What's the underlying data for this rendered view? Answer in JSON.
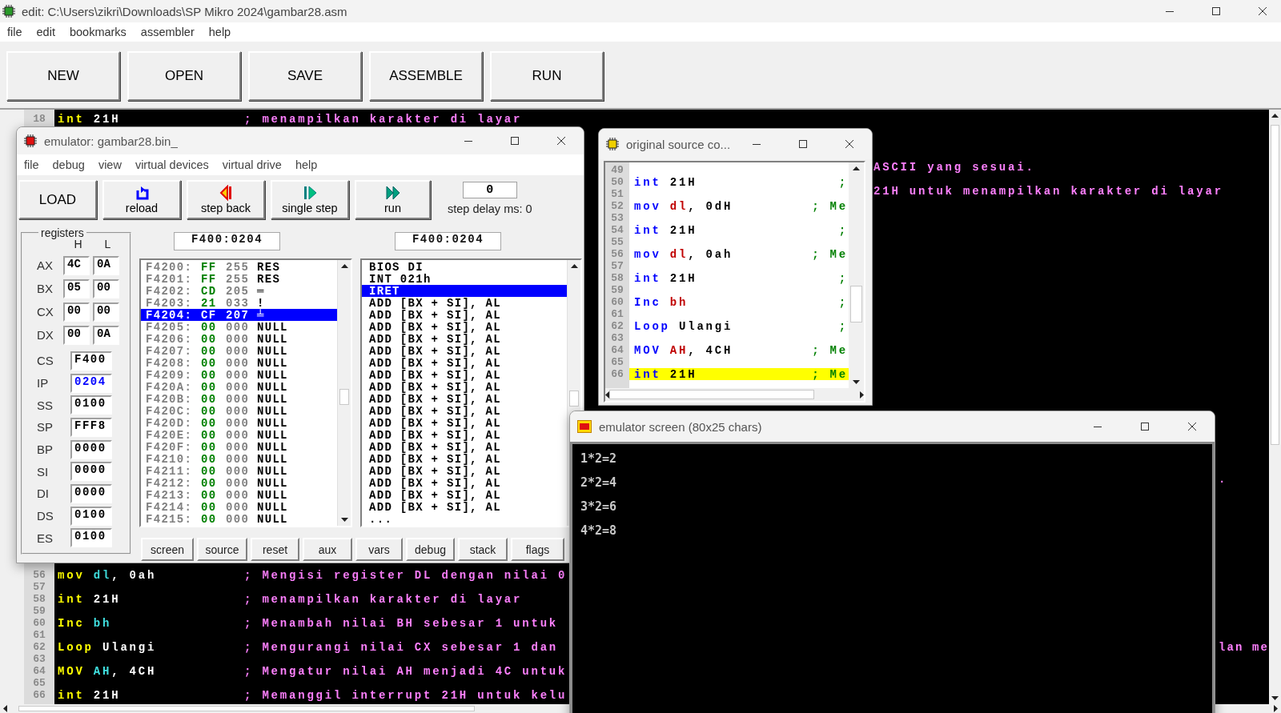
{
  "window": {
    "title": "edit: C:\\Users\\zikri\\Downloads\\SP Mikro 2024\\gambar28.asm"
  },
  "menu": [
    "file",
    "edit",
    "bookmarks",
    "assembler",
    "help"
  ],
  "toolbar": [
    "NEW",
    "OPEN",
    "SAVE",
    "ASSEMBLE",
    "RUN"
  ],
  "editor": {
    "lines": [
      {
        "kind": "code",
        "number": "18",
        "code": [
          {
            "text": "int",
            "kind": "mnemonic"
          },
          {
            "text": " 21H",
            "kind": "operand"
          }
        ],
        "comment": "; menampilkan karakter di layar"
      },
      {
        "kind": "blank"
      },
      {
        "kind": "blank"
      },
      {
        "kind": "blank"
      },
      {
        "kind": "tail",
        "text": "ASCII yang sesuai."
      },
      {
        "kind": "blank"
      },
      {
        "kind": "tail",
        "text": "21H untuk menampilkan karakter di layar"
      },
      {
        "kind": "blank"
      },
      {
        "kind": "blank"
      },
      {
        "kind": "blank"
      },
      {
        "kind": "blank"
      },
      {
        "kind": "blank"
      },
      {
        "kind": "blank"
      },
      {
        "kind": "blank"
      },
      {
        "kind": "blank"
      },
      {
        "kind": "blank"
      },
      {
        "kind": "blank"
      },
      {
        "kind": "blank"
      },
      {
        "kind": "blank"
      },
      {
        "kind": "blank"
      },
      {
        "kind": "blank"
      },
      {
        "kind": "blank"
      },
      {
        "kind": "blank"
      },
      {
        "kind": "blank"
      },
      {
        "kind": "blank"
      },
      {
        "kind": "blank"
      },
      {
        "kind": "blank"
      },
      {
        "kind": "blank"
      },
      {
        "kind": "blank"
      },
      {
        "kind": "blank"
      },
      {
        "kind": "edge",
        "text": "."
      },
      {
        "kind": "blank"
      },
      {
        "kind": "blank"
      },
      {
        "kind": "blank"
      },
      {
        "kind": "blank"
      },
      {
        "kind": "blank"
      },
      {
        "kind": "blank"
      },
      {
        "kind": "blank"
      },
      {
        "kind": "code",
        "number": "56",
        "code": [
          {
            "text": "mov",
            "kind": "mnemonic"
          },
          {
            "text": " dl",
            "kind": "register"
          },
          {
            "text": ", 0ah",
            "kind": "operand"
          }
        ],
        "comment": "; Mengisi register DL dengan nilai 0"
      },
      {
        "kind": "number",
        "number": "57"
      },
      {
        "kind": "code",
        "number": "58",
        "code": [
          {
            "text": "int",
            "kind": "mnemonic"
          },
          {
            "text": " 21H",
            "kind": "operand"
          }
        ],
        "comment": "; menampilkan karakter di layar"
      },
      {
        "kind": "number",
        "number": "59"
      },
      {
        "kind": "code",
        "number": "60",
        "code": [
          {
            "text": "Inc",
            "kind": "mnemonic"
          },
          {
            "text": " bh",
            "kind": "register"
          }
        ],
        "comment": "; Menambah nilai BH sebesar 1 untuk"
      },
      {
        "kind": "number",
        "number": "61"
      },
      {
        "kind": "code",
        "number": "62",
        "code": [
          {
            "text": "Loop",
            "kind": "mnemonic"
          },
          {
            "text": " Ulangi",
            "kind": "operand"
          }
        ],
        "comment": "; Mengurangi nilai CX sebesar 1 dan",
        "far": "lan me"
      },
      {
        "kind": "number",
        "number": "63"
      },
      {
        "kind": "code",
        "number": "64",
        "code": [
          {
            "text": "MOV",
            "kind": "mnemonic"
          },
          {
            "text": " AH",
            "kind": "register"
          },
          {
            "text": ", 4CH",
            "kind": "operand"
          }
        ],
        "comment": "; Mengatur nilai AH menjadi 4C untuk"
      },
      {
        "kind": "number",
        "number": "65"
      },
      {
        "kind": "code",
        "number": "66",
        "code": [
          {
            "text": "int",
            "kind": "mnemonic"
          },
          {
            "text": " 21H",
            "kind": "operand"
          }
        ],
        "comment": "; Memanggil interrupt 21H untuk kelu"
      }
    ]
  },
  "emulator": {
    "title": "emulator: gambar28.bin_",
    "menu": [
      "file",
      "debug",
      "view",
      "virtual devices",
      "virtual drive",
      "help"
    ],
    "toolbar": [
      {
        "label": "LOAD",
        "kind": "text"
      },
      {
        "label": "reload",
        "kind": "reload"
      },
      {
        "label": "step back",
        "kind": "step-back"
      },
      {
        "label": "single step",
        "kind": "single-step"
      },
      {
        "label": "run",
        "kind": "run"
      }
    ],
    "step_delay": {
      "value": "0",
      "label": "step delay ms: 0"
    },
    "registers": {
      "title": "registers",
      "columns": [
        "H",
        "L"
      ],
      "pairs": [
        {
          "name": "AX",
          "high": "4C",
          "low": "0A"
        },
        {
          "name": "BX",
          "high": "05",
          "low": "00"
        },
        {
          "name": "CX",
          "high": "00",
          "low": "00"
        },
        {
          "name": "DX",
          "high": "00",
          "low": "0A"
        }
      ],
      "words": [
        {
          "name": "CS",
          "value": "F400",
          "changed": false
        },
        {
          "name": "IP",
          "value": "0204",
          "changed": true
        },
        {
          "name": "SS",
          "value": "0100",
          "changed": false
        },
        {
          "name": "SP",
          "value": "FFF8",
          "changed": false
        },
        {
          "name": "BP",
          "value": "0000",
          "changed": false
        },
        {
          "name": "SI",
          "value": "0000",
          "changed": false
        },
        {
          "name": "DI",
          "value": "0000",
          "changed": false
        },
        {
          "name": "DS",
          "value": "0100",
          "changed": false
        },
        {
          "name": "ES",
          "value": "0100",
          "changed": false
        }
      ]
    },
    "memory": {
      "address": "F400:0204",
      "rows": [
        {
          "address": "F4200:",
          "hex": "FF",
          "dec": "255",
          "char": "RES",
          "selected": false
        },
        {
          "address": "F4201:",
          "hex": "FF",
          "dec": "255",
          "char": "RES",
          "selected": false
        },
        {
          "address": "F4202:",
          "hex": "CD",
          "dec": "205",
          "char": "═",
          "selected": false
        },
        {
          "address": "F4203:",
          "hex": "21",
          "dec": "033",
          "char": "!",
          "selected": false
        },
        {
          "address": "F4204:",
          "hex": "CF",
          "dec": "207",
          "char": "╧",
          "selected": true
        },
        {
          "address": "F4205:",
          "hex": "00",
          "dec": "000",
          "char": "NULL",
          "selected": false
        },
        {
          "address": "F4206:",
          "hex": "00",
          "dec": "000",
          "char": "NULL",
          "selected": false
        },
        {
          "address": "F4207:",
          "hex": "00",
          "dec": "000",
          "char": "NULL",
          "selected": false
        },
        {
          "address": "F4208:",
          "hex": "00",
          "dec": "000",
          "char": "NULL",
          "selected": false
        },
        {
          "address": "F4209:",
          "hex": "00",
          "dec": "000",
          "char": "NULL",
          "selected": false
        },
        {
          "address": "F420A:",
          "hex": "00",
          "dec": "000",
          "char": "NULL",
          "selected": false
        },
        {
          "address": "F420B:",
          "hex": "00",
          "dec": "000",
          "char": "NULL",
          "selected": false
        },
        {
          "address": "F420C:",
          "hex": "00",
          "dec": "000",
          "char": "NULL",
          "selected": false
        },
        {
          "address": "F420D:",
          "hex": "00",
          "dec": "000",
          "char": "NULL",
          "selected": false
        },
        {
          "address": "F420E:",
          "hex": "00",
          "dec": "000",
          "char": "NULL",
          "selected": false
        },
        {
          "address": "F420F:",
          "hex": "00",
          "dec": "000",
          "char": "NULL",
          "selected": false
        },
        {
          "address": "F4210:",
          "hex": "00",
          "dec": "000",
          "char": "NULL",
          "selected": false
        },
        {
          "address": "F4211:",
          "hex": "00",
          "dec": "000",
          "char": "NULL",
          "selected": false
        },
        {
          "address": "F4212:",
          "hex": "00",
          "dec": "000",
          "char": "NULL",
          "selected": false
        },
        {
          "address": "F4213:",
          "hex": "00",
          "dec": "000",
          "char": "NULL",
          "selected": false
        },
        {
          "address": "F4214:",
          "hex": "00",
          "dec": "000",
          "char": "NULL",
          "selected": false
        },
        {
          "address": "F4215:",
          "hex": "00",
          "dec": "000",
          "char": "NULL",
          "selected": false
        }
      ]
    },
    "disassembly": {
      "address": "F400:0204",
      "rows": [
        {
          "text": "BIOS DI",
          "selected": false
        },
        {
          "text": "INT 021h",
          "selected": false
        },
        {
          "text": "IRET",
          "selected": true
        },
        {
          "text": "ADD [BX + SI], AL",
          "selected": false
        },
        {
          "text": "ADD [BX + SI], AL",
          "selected": false
        },
        {
          "text": "ADD [BX + SI], AL",
          "selected": false
        },
        {
          "text": "ADD [BX + SI], AL",
          "selected": false
        },
        {
          "text": "ADD [BX + SI], AL",
          "selected": false
        },
        {
          "text": "ADD [BX + SI], AL",
          "selected": false
        },
        {
          "text": "ADD [BX + SI], AL",
          "selected": false
        },
        {
          "text": "ADD [BX + SI], AL",
          "selected": false
        },
        {
          "text": "ADD [BX + SI], AL",
          "selected": false
        },
        {
          "text": "ADD [BX + SI], AL",
          "selected": false
        },
        {
          "text": "ADD [BX + SI], AL",
          "selected": false
        },
        {
          "text": "ADD [BX + SI], AL",
          "selected": false
        },
        {
          "text": "ADD [BX + SI], AL",
          "selected": false
        },
        {
          "text": "ADD [BX + SI], AL",
          "selected": false
        },
        {
          "text": "ADD [BX + SI], AL",
          "selected": false
        },
        {
          "text": "ADD [BX + SI], AL",
          "selected": false
        },
        {
          "text": "ADD [BX + SI], AL",
          "selected": false
        },
        {
          "text": "ADD [BX + SI], AL",
          "selected": false
        },
        {
          "text": "...",
          "selected": false
        }
      ]
    },
    "buttons": [
      "screen",
      "source",
      "reset",
      "aux",
      "vars",
      "debug",
      "stack",
      "flags"
    ]
  },
  "source_window": {
    "title": "original source co...",
    "lines": [
      {
        "number": "49"
      },
      {
        "number": "50",
        "code": [
          {
            "text": "int",
            "kind": "mnemonic"
          },
          {
            "text": " 21H",
            "kind": "operand"
          }
        ],
        "comment": ";",
        "highlighted": false
      },
      {
        "number": "51"
      },
      {
        "number": "52",
        "code": [
          {
            "text": "mov",
            "kind": "mnemonic"
          },
          {
            "text": " dl",
            "kind": "register"
          },
          {
            "text": ", 0dH",
            "kind": "operand"
          }
        ],
        "comment": "; Me",
        "highlighted": false
      },
      {
        "number": "53"
      },
      {
        "number": "54",
        "code": [
          {
            "text": "int",
            "kind": "mnemonic"
          },
          {
            "text": " 21H",
            "kind": "operand"
          }
        ],
        "comment": ";",
        "highlighted": false
      },
      {
        "number": "55"
      },
      {
        "number": "56",
        "code": [
          {
            "text": "mov",
            "kind": "mnemonic"
          },
          {
            "text": " dl",
            "kind": "register"
          },
          {
            "text": ", 0ah",
            "kind": "operand"
          }
        ],
        "comment": "; Me",
        "highlighted": false
      },
      {
        "number": "57"
      },
      {
        "number": "58",
        "code": [
          {
            "text": "int",
            "kind": "mnemonic"
          },
          {
            "text": " 21H",
            "kind": "operand"
          }
        ],
        "comment": ";",
        "highlighted": false
      },
      {
        "number": "59"
      },
      {
        "number": "60",
        "code": [
          {
            "text": "Inc",
            "kind": "mnemonic"
          },
          {
            "text": " bh",
            "kind": "register"
          }
        ],
        "comment": ";",
        "highlighted": false
      },
      {
        "number": "61"
      },
      {
        "number": "62",
        "code": [
          {
            "text": "Loop",
            "kind": "mnemonic"
          },
          {
            "text": " Ulangi",
            "kind": "operand"
          }
        ],
        "comment": ";",
        "highlighted": false
      },
      {
        "number": "63"
      },
      {
        "number": "64",
        "code": [
          {
            "text": "MOV",
            "kind": "mnemonic"
          },
          {
            "text": " AH",
            "kind": "register"
          },
          {
            "text": ", 4CH",
            "kind": "operand"
          }
        ],
        "comment": "; Me",
        "highlighted": false
      },
      {
        "number": "65"
      },
      {
        "number": "66",
        "code": [
          {
            "text": "int",
            "kind": "mnemonic"
          },
          {
            "text": " 21H",
            "kind": "operand"
          }
        ],
        "comment": "; Me",
        "highlighted": true
      }
    ]
  },
  "screen_window": {
    "title": "emulator screen (80x25 chars)",
    "output": [
      "1*2=2",
      "2*2=4",
      "3*2=6",
      "4*2=8"
    ]
  }
}
